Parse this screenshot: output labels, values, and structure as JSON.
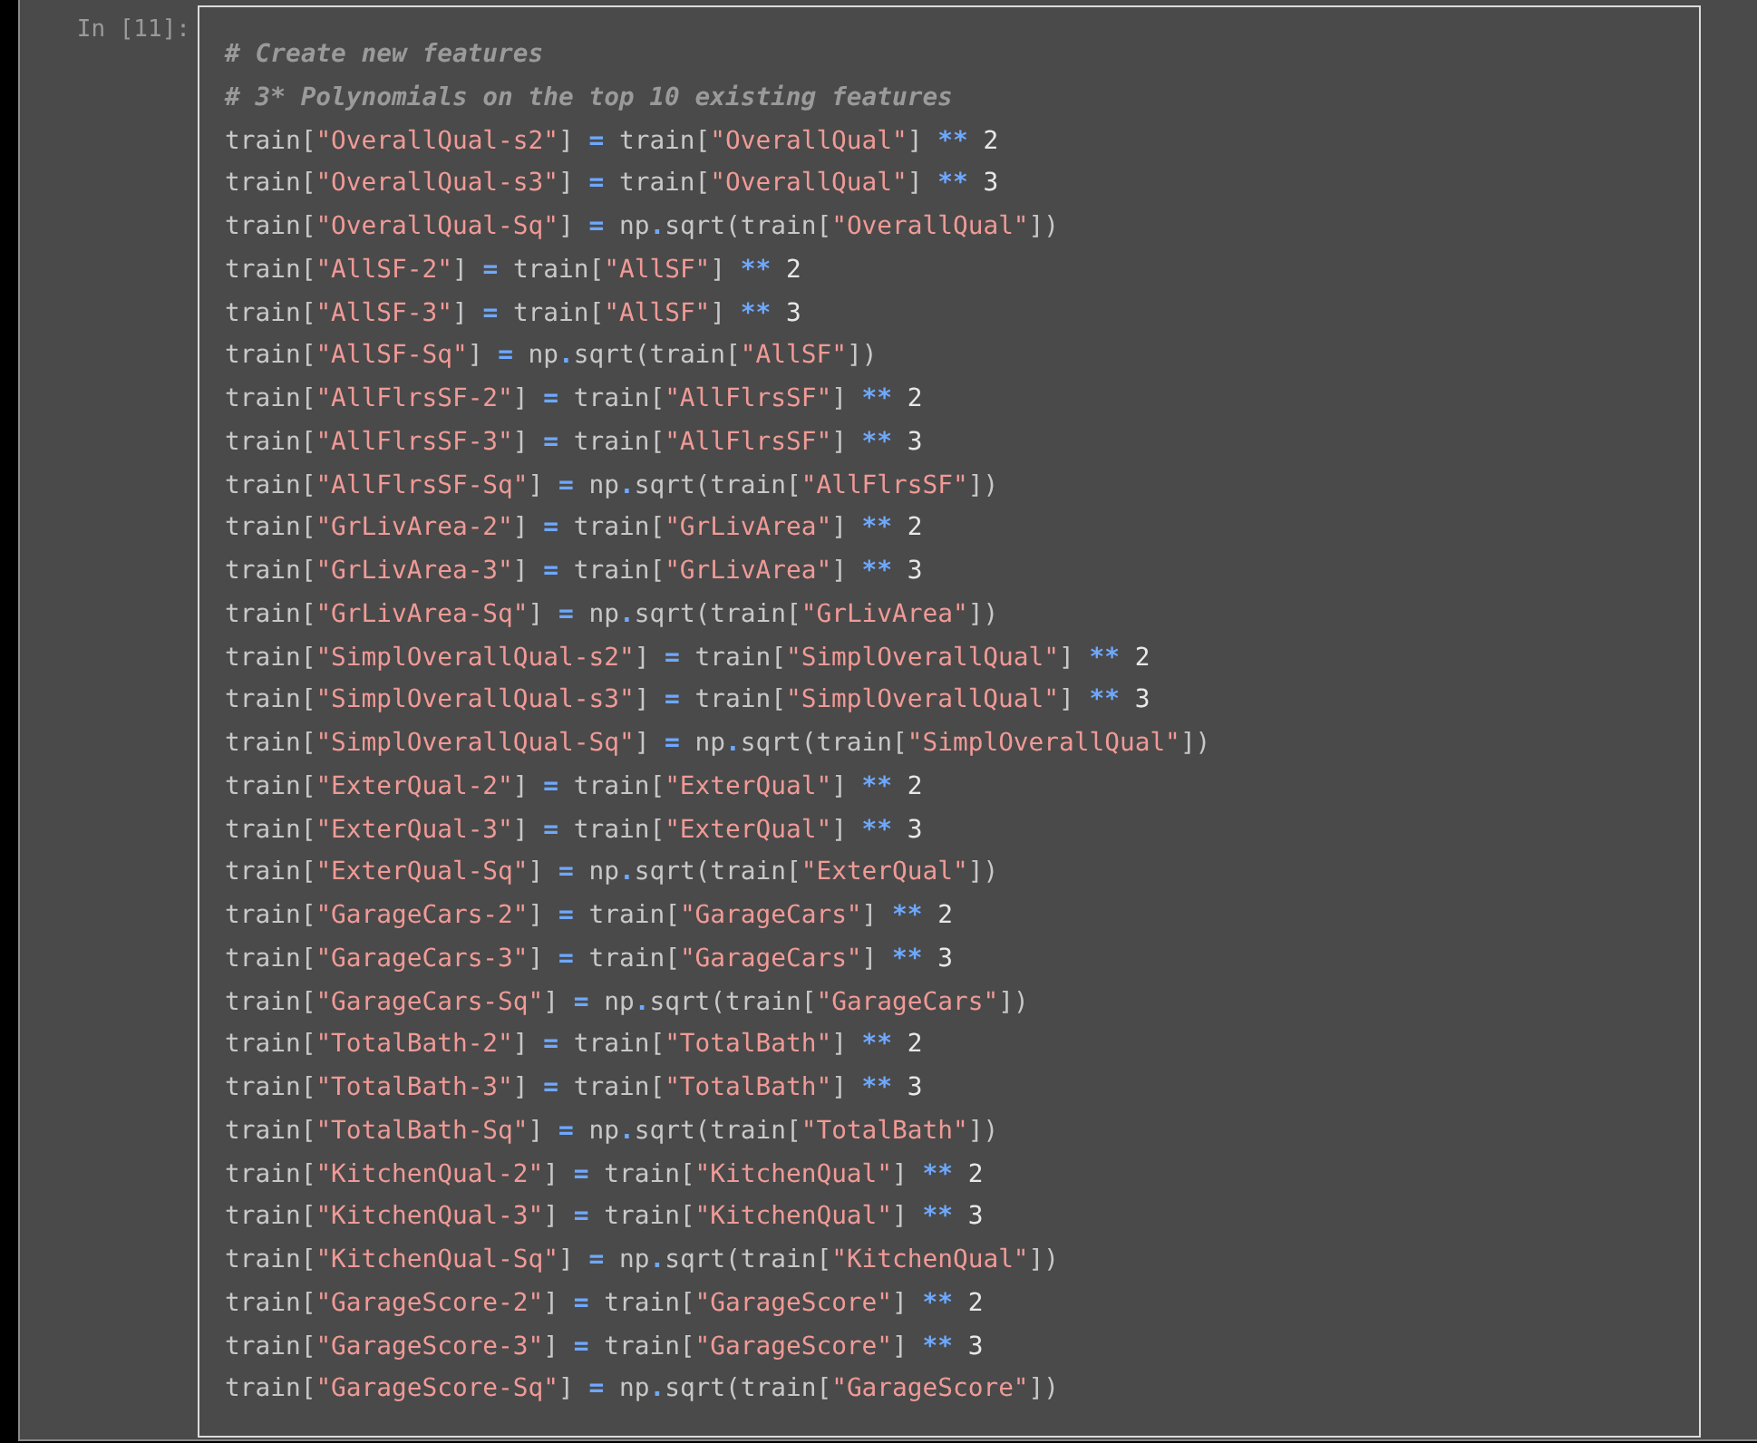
{
  "cell": {
    "prompt": "In [11]:",
    "lines": [
      [
        {
          "kind": "comment",
          "text": "# Create new features"
        }
      ],
      [
        {
          "kind": "comment",
          "text": "# 3* Polynomials on the top 10 existing features"
        }
      ],
      [
        {
          "kind": "plain",
          "text": "train["
        },
        {
          "kind": "string",
          "text": "\"OverallQual-s2\""
        },
        {
          "kind": "plain",
          "text": "] "
        },
        {
          "kind": "operator",
          "text": "="
        },
        {
          "kind": "plain",
          "text": " train["
        },
        {
          "kind": "string",
          "text": "\"OverallQual\""
        },
        {
          "kind": "plain",
          "text": "] "
        },
        {
          "kind": "operator",
          "text": "**"
        },
        {
          "kind": "number",
          "text": " 2"
        }
      ],
      [
        {
          "kind": "plain",
          "text": "train["
        },
        {
          "kind": "string",
          "text": "\"OverallQual-s3\""
        },
        {
          "kind": "plain",
          "text": "] "
        },
        {
          "kind": "operator",
          "text": "="
        },
        {
          "kind": "plain",
          "text": " train["
        },
        {
          "kind": "string",
          "text": "\"OverallQual\""
        },
        {
          "kind": "plain",
          "text": "] "
        },
        {
          "kind": "operator",
          "text": "**"
        },
        {
          "kind": "number",
          "text": " 3"
        }
      ],
      [
        {
          "kind": "plain",
          "text": "train["
        },
        {
          "kind": "string",
          "text": "\"OverallQual-Sq\""
        },
        {
          "kind": "plain",
          "text": "] "
        },
        {
          "kind": "operator",
          "text": "="
        },
        {
          "kind": "plain",
          "text": " np"
        },
        {
          "kind": "operator",
          "text": "."
        },
        {
          "kind": "plain",
          "text": "sqrt(train["
        },
        {
          "kind": "string",
          "text": "\"OverallQual\""
        },
        {
          "kind": "plain",
          "text": "])"
        }
      ],
      [
        {
          "kind": "plain",
          "text": "train["
        },
        {
          "kind": "string",
          "text": "\"AllSF-2\""
        },
        {
          "kind": "plain",
          "text": "] "
        },
        {
          "kind": "operator",
          "text": "="
        },
        {
          "kind": "plain",
          "text": " train["
        },
        {
          "kind": "string",
          "text": "\"AllSF\""
        },
        {
          "kind": "plain",
          "text": "] "
        },
        {
          "kind": "operator",
          "text": "**"
        },
        {
          "kind": "number",
          "text": " 2"
        }
      ],
      [
        {
          "kind": "plain",
          "text": "train["
        },
        {
          "kind": "string",
          "text": "\"AllSF-3\""
        },
        {
          "kind": "plain",
          "text": "] "
        },
        {
          "kind": "operator",
          "text": "="
        },
        {
          "kind": "plain",
          "text": " train["
        },
        {
          "kind": "string",
          "text": "\"AllSF\""
        },
        {
          "kind": "plain",
          "text": "] "
        },
        {
          "kind": "operator",
          "text": "**"
        },
        {
          "kind": "number",
          "text": " 3"
        }
      ],
      [
        {
          "kind": "plain",
          "text": "train["
        },
        {
          "kind": "string",
          "text": "\"AllSF-Sq\""
        },
        {
          "kind": "plain",
          "text": "] "
        },
        {
          "kind": "operator",
          "text": "="
        },
        {
          "kind": "plain",
          "text": " np"
        },
        {
          "kind": "operator",
          "text": "."
        },
        {
          "kind": "plain",
          "text": "sqrt(train["
        },
        {
          "kind": "string",
          "text": "\"AllSF\""
        },
        {
          "kind": "plain",
          "text": "])"
        }
      ],
      [
        {
          "kind": "plain",
          "text": "train["
        },
        {
          "kind": "string",
          "text": "\"AllFlrsSF-2\""
        },
        {
          "kind": "plain",
          "text": "] "
        },
        {
          "kind": "operator",
          "text": "="
        },
        {
          "kind": "plain",
          "text": " train["
        },
        {
          "kind": "string",
          "text": "\"AllFlrsSF\""
        },
        {
          "kind": "plain",
          "text": "] "
        },
        {
          "kind": "operator",
          "text": "**"
        },
        {
          "kind": "number",
          "text": " 2"
        }
      ],
      [
        {
          "kind": "plain",
          "text": "train["
        },
        {
          "kind": "string",
          "text": "\"AllFlrsSF-3\""
        },
        {
          "kind": "plain",
          "text": "] "
        },
        {
          "kind": "operator",
          "text": "="
        },
        {
          "kind": "plain",
          "text": " train["
        },
        {
          "kind": "string",
          "text": "\"AllFlrsSF\""
        },
        {
          "kind": "plain",
          "text": "] "
        },
        {
          "kind": "operator",
          "text": "**"
        },
        {
          "kind": "number",
          "text": " 3"
        }
      ],
      [
        {
          "kind": "plain",
          "text": "train["
        },
        {
          "kind": "string",
          "text": "\"AllFlrsSF-Sq\""
        },
        {
          "kind": "plain",
          "text": "] "
        },
        {
          "kind": "operator",
          "text": "="
        },
        {
          "kind": "plain",
          "text": " np"
        },
        {
          "kind": "operator",
          "text": "."
        },
        {
          "kind": "plain",
          "text": "sqrt(train["
        },
        {
          "kind": "string",
          "text": "\"AllFlrsSF\""
        },
        {
          "kind": "plain",
          "text": "])"
        }
      ],
      [
        {
          "kind": "plain",
          "text": "train["
        },
        {
          "kind": "string",
          "text": "\"GrLivArea-2\""
        },
        {
          "kind": "plain",
          "text": "] "
        },
        {
          "kind": "operator",
          "text": "="
        },
        {
          "kind": "plain",
          "text": " train["
        },
        {
          "kind": "string",
          "text": "\"GrLivArea\""
        },
        {
          "kind": "plain",
          "text": "] "
        },
        {
          "kind": "operator",
          "text": "**"
        },
        {
          "kind": "number",
          "text": " 2"
        }
      ],
      [
        {
          "kind": "plain",
          "text": "train["
        },
        {
          "kind": "string",
          "text": "\"GrLivArea-3\""
        },
        {
          "kind": "plain",
          "text": "] "
        },
        {
          "kind": "operator",
          "text": "="
        },
        {
          "kind": "plain",
          "text": " train["
        },
        {
          "kind": "string",
          "text": "\"GrLivArea\""
        },
        {
          "kind": "plain",
          "text": "] "
        },
        {
          "kind": "operator",
          "text": "**"
        },
        {
          "kind": "number",
          "text": " 3"
        }
      ],
      [
        {
          "kind": "plain",
          "text": "train["
        },
        {
          "kind": "string",
          "text": "\"GrLivArea-Sq\""
        },
        {
          "kind": "plain",
          "text": "] "
        },
        {
          "kind": "operator",
          "text": "="
        },
        {
          "kind": "plain",
          "text": " np"
        },
        {
          "kind": "operator",
          "text": "."
        },
        {
          "kind": "plain",
          "text": "sqrt(train["
        },
        {
          "kind": "string",
          "text": "\"GrLivArea\""
        },
        {
          "kind": "plain",
          "text": "])"
        }
      ],
      [
        {
          "kind": "plain",
          "text": "train["
        },
        {
          "kind": "string",
          "text": "\"SimplOverallQual-s2\""
        },
        {
          "kind": "plain",
          "text": "] "
        },
        {
          "kind": "operator",
          "text": "="
        },
        {
          "kind": "plain",
          "text": " train["
        },
        {
          "kind": "string",
          "text": "\"SimplOverallQual\""
        },
        {
          "kind": "plain",
          "text": "] "
        },
        {
          "kind": "operator",
          "text": "**"
        },
        {
          "kind": "number",
          "text": " 2"
        }
      ],
      [
        {
          "kind": "plain",
          "text": "train["
        },
        {
          "kind": "string",
          "text": "\"SimplOverallQual-s3\""
        },
        {
          "kind": "plain",
          "text": "] "
        },
        {
          "kind": "operator",
          "text": "="
        },
        {
          "kind": "plain",
          "text": " train["
        },
        {
          "kind": "string",
          "text": "\"SimplOverallQual\""
        },
        {
          "kind": "plain",
          "text": "] "
        },
        {
          "kind": "operator",
          "text": "**"
        },
        {
          "kind": "number",
          "text": " 3"
        }
      ],
      [
        {
          "kind": "plain",
          "text": "train["
        },
        {
          "kind": "string",
          "text": "\"SimplOverallQual-Sq\""
        },
        {
          "kind": "plain",
          "text": "] "
        },
        {
          "kind": "operator",
          "text": "="
        },
        {
          "kind": "plain",
          "text": " np"
        },
        {
          "kind": "operator",
          "text": "."
        },
        {
          "kind": "plain",
          "text": "sqrt(train["
        },
        {
          "kind": "string",
          "text": "\"SimplOverallQual\""
        },
        {
          "kind": "plain",
          "text": "])"
        }
      ],
      [
        {
          "kind": "plain",
          "text": "train["
        },
        {
          "kind": "string",
          "text": "\"ExterQual-2\""
        },
        {
          "kind": "plain",
          "text": "] "
        },
        {
          "kind": "operator",
          "text": "="
        },
        {
          "kind": "plain",
          "text": " train["
        },
        {
          "kind": "string",
          "text": "\"ExterQual\""
        },
        {
          "kind": "plain",
          "text": "] "
        },
        {
          "kind": "operator",
          "text": "**"
        },
        {
          "kind": "number",
          "text": " 2"
        }
      ],
      [
        {
          "kind": "plain",
          "text": "train["
        },
        {
          "kind": "string",
          "text": "\"ExterQual-3\""
        },
        {
          "kind": "plain",
          "text": "] "
        },
        {
          "kind": "operator",
          "text": "="
        },
        {
          "kind": "plain",
          "text": " train["
        },
        {
          "kind": "string",
          "text": "\"ExterQual\""
        },
        {
          "kind": "plain",
          "text": "] "
        },
        {
          "kind": "operator",
          "text": "**"
        },
        {
          "kind": "number",
          "text": " 3"
        }
      ],
      [
        {
          "kind": "plain",
          "text": "train["
        },
        {
          "kind": "string",
          "text": "\"ExterQual-Sq\""
        },
        {
          "kind": "plain",
          "text": "] "
        },
        {
          "kind": "operator",
          "text": "="
        },
        {
          "kind": "plain",
          "text": " np"
        },
        {
          "kind": "operator",
          "text": "."
        },
        {
          "kind": "plain",
          "text": "sqrt(train["
        },
        {
          "kind": "string",
          "text": "\"ExterQual\""
        },
        {
          "kind": "plain",
          "text": "])"
        }
      ],
      [
        {
          "kind": "plain",
          "text": "train["
        },
        {
          "kind": "string",
          "text": "\"GarageCars-2\""
        },
        {
          "kind": "plain",
          "text": "] "
        },
        {
          "kind": "operator",
          "text": "="
        },
        {
          "kind": "plain",
          "text": " train["
        },
        {
          "kind": "string",
          "text": "\"GarageCars\""
        },
        {
          "kind": "plain",
          "text": "] "
        },
        {
          "kind": "operator",
          "text": "**"
        },
        {
          "kind": "number",
          "text": " 2"
        }
      ],
      [
        {
          "kind": "plain",
          "text": "train["
        },
        {
          "kind": "string",
          "text": "\"GarageCars-3\""
        },
        {
          "kind": "plain",
          "text": "] "
        },
        {
          "kind": "operator",
          "text": "="
        },
        {
          "kind": "plain",
          "text": " train["
        },
        {
          "kind": "string",
          "text": "\"GarageCars\""
        },
        {
          "kind": "plain",
          "text": "] "
        },
        {
          "kind": "operator",
          "text": "**"
        },
        {
          "kind": "number",
          "text": " 3"
        }
      ],
      [
        {
          "kind": "plain",
          "text": "train["
        },
        {
          "kind": "string",
          "text": "\"GarageCars-Sq\""
        },
        {
          "kind": "plain",
          "text": "] "
        },
        {
          "kind": "operator",
          "text": "="
        },
        {
          "kind": "plain",
          "text": " np"
        },
        {
          "kind": "operator",
          "text": "."
        },
        {
          "kind": "plain",
          "text": "sqrt(train["
        },
        {
          "kind": "string",
          "text": "\"GarageCars\""
        },
        {
          "kind": "plain",
          "text": "])"
        }
      ],
      [
        {
          "kind": "plain",
          "text": "train["
        },
        {
          "kind": "string",
          "text": "\"TotalBath-2\""
        },
        {
          "kind": "plain",
          "text": "] "
        },
        {
          "kind": "operator",
          "text": "="
        },
        {
          "kind": "plain",
          "text": " train["
        },
        {
          "kind": "string",
          "text": "\"TotalBath\""
        },
        {
          "kind": "plain",
          "text": "] "
        },
        {
          "kind": "operator",
          "text": "**"
        },
        {
          "kind": "number",
          "text": " 2"
        }
      ],
      [
        {
          "kind": "plain",
          "text": "train["
        },
        {
          "kind": "string",
          "text": "\"TotalBath-3\""
        },
        {
          "kind": "plain",
          "text": "] "
        },
        {
          "kind": "operator",
          "text": "="
        },
        {
          "kind": "plain",
          "text": " train["
        },
        {
          "kind": "string",
          "text": "\"TotalBath\""
        },
        {
          "kind": "plain",
          "text": "] "
        },
        {
          "kind": "operator",
          "text": "**"
        },
        {
          "kind": "number",
          "text": " 3"
        }
      ],
      [
        {
          "kind": "plain",
          "text": "train["
        },
        {
          "kind": "string",
          "text": "\"TotalBath-Sq\""
        },
        {
          "kind": "plain",
          "text": "] "
        },
        {
          "kind": "operator",
          "text": "="
        },
        {
          "kind": "plain",
          "text": " np"
        },
        {
          "kind": "operator",
          "text": "."
        },
        {
          "kind": "plain",
          "text": "sqrt(train["
        },
        {
          "kind": "string",
          "text": "\"TotalBath\""
        },
        {
          "kind": "plain",
          "text": "])"
        }
      ],
      [
        {
          "kind": "plain",
          "text": "train["
        },
        {
          "kind": "string",
          "text": "\"KitchenQual-2\""
        },
        {
          "kind": "plain",
          "text": "] "
        },
        {
          "kind": "operator",
          "text": "="
        },
        {
          "kind": "plain",
          "text": " train["
        },
        {
          "kind": "string",
          "text": "\"KitchenQual\""
        },
        {
          "kind": "plain",
          "text": "] "
        },
        {
          "kind": "operator",
          "text": "**"
        },
        {
          "kind": "number",
          "text": " 2"
        }
      ],
      [
        {
          "kind": "plain",
          "text": "train["
        },
        {
          "kind": "string",
          "text": "\"KitchenQual-3\""
        },
        {
          "kind": "plain",
          "text": "] "
        },
        {
          "kind": "operator",
          "text": "="
        },
        {
          "kind": "plain",
          "text": " train["
        },
        {
          "kind": "string",
          "text": "\"KitchenQual\""
        },
        {
          "kind": "plain",
          "text": "] "
        },
        {
          "kind": "operator",
          "text": "**"
        },
        {
          "kind": "number",
          "text": " 3"
        }
      ],
      [
        {
          "kind": "plain",
          "text": "train["
        },
        {
          "kind": "string",
          "text": "\"KitchenQual-Sq\""
        },
        {
          "kind": "plain",
          "text": "] "
        },
        {
          "kind": "operator",
          "text": "="
        },
        {
          "kind": "plain",
          "text": " np"
        },
        {
          "kind": "operator",
          "text": "."
        },
        {
          "kind": "plain",
          "text": "sqrt(train["
        },
        {
          "kind": "string",
          "text": "\"KitchenQual\""
        },
        {
          "kind": "plain",
          "text": "])"
        }
      ],
      [
        {
          "kind": "plain",
          "text": "train["
        },
        {
          "kind": "string",
          "text": "\"GarageScore-2\""
        },
        {
          "kind": "plain",
          "text": "] "
        },
        {
          "kind": "operator",
          "text": "="
        },
        {
          "kind": "plain",
          "text": " train["
        },
        {
          "kind": "string",
          "text": "\"GarageScore\""
        },
        {
          "kind": "plain",
          "text": "] "
        },
        {
          "kind": "operator",
          "text": "**"
        },
        {
          "kind": "number",
          "text": " 2"
        }
      ],
      [
        {
          "kind": "plain",
          "text": "train["
        },
        {
          "kind": "string",
          "text": "\"GarageScore-3\""
        },
        {
          "kind": "plain",
          "text": "] "
        },
        {
          "kind": "operator",
          "text": "="
        },
        {
          "kind": "plain",
          "text": " train["
        },
        {
          "kind": "string",
          "text": "\"GarageScore\""
        },
        {
          "kind": "plain",
          "text": "] "
        },
        {
          "kind": "operator",
          "text": "**"
        },
        {
          "kind": "number",
          "text": " 3"
        }
      ],
      [
        {
          "kind": "plain",
          "text": "train["
        },
        {
          "kind": "string",
          "text": "\"GarageScore-Sq\""
        },
        {
          "kind": "plain",
          "text": "] "
        },
        {
          "kind": "operator",
          "text": "="
        },
        {
          "kind": "plain",
          "text": " np"
        },
        {
          "kind": "operator",
          "text": "."
        },
        {
          "kind": "plain",
          "text": "sqrt(train["
        },
        {
          "kind": "string",
          "text": "\"GarageScore\""
        },
        {
          "kind": "plain",
          "text": "])"
        }
      ]
    ]
  }
}
